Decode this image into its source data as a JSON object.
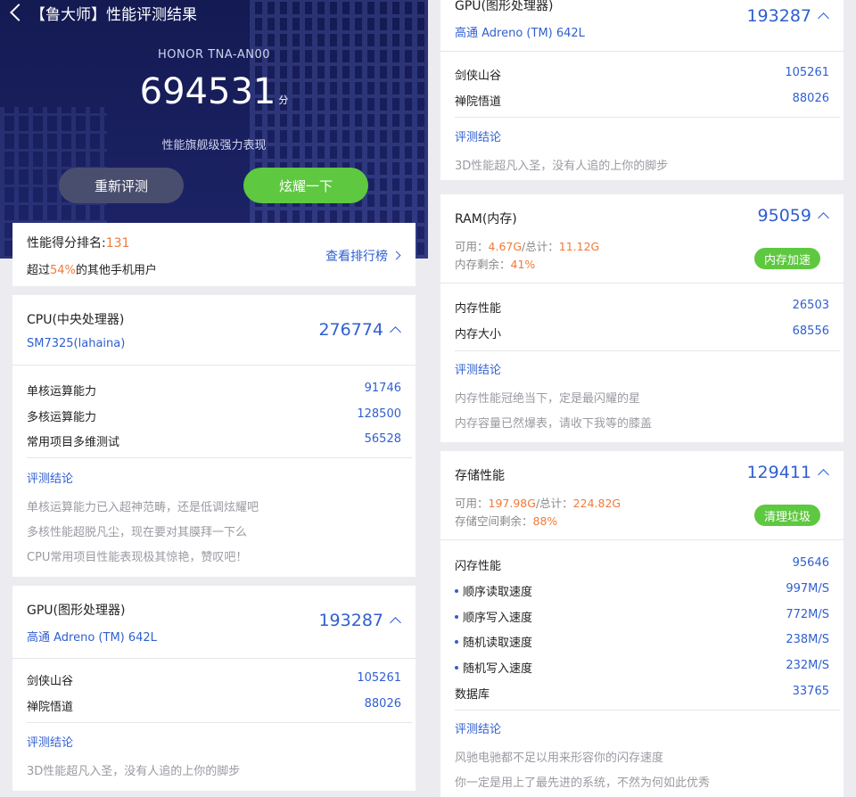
{
  "header": {
    "title": "【鲁大师】性能评测结果",
    "model": "HONOR TNA-AN00",
    "score": "694531",
    "unit": "分",
    "slogan": "性能旗舰级强力表现",
    "retest": "重新评测",
    "show_off": "炫耀一下"
  },
  "rank": {
    "label": "性能得分排名:",
    "rank": "131",
    "prefix": "超过",
    "percent": "54%",
    "suffix": "的其他手机用户",
    "link": "查看排行榜"
  },
  "cpu": {
    "name": "CPU(中央处理器)",
    "model": "SM7325(lahaina)",
    "score": "276774",
    "rows": [
      {
        "label": "单核运算能力",
        "value": "91746"
      },
      {
        "label": "多核运算能力",
        "value": "128500"
      },
      {
        "label": "常用项目多维测试",
        "value": "56528"
      }
    ],
    "conclusion": "评测结论",
    "lines": [
      "单核运算能力已入超神范畴，还是低调炫耀吧",
      "多核性能超脱凡尘，现在要对其膜拜一下么",
      "CPU常用项目性能表现极其惊艳，赞叹吧！"
    ]
  },
  "gpu": {
    "name": "GPU(图形处理器)",
    "model": "高通 Adreno (TM) 642L",
    "score": "193287",
    "rows": [
      {
        "label": "剑侠山谷",
        "value": "105261"
      },
      {
        "label": "禅院悟道",
        "value": "88026"
      }
    ],
    "conclusion": "评测结论",
    "lines": [
      "3D性能超凡入圣，没有人追的上你的脚步"
    ]
  },
  "ram": {
    "name": "RAM(内存)",
    "score": "95059",
    "avail_label": "可用：",
    "avail": "4.67G",
    "total_label": "/总计：",
    "total": "11.12G",
    "remain_label": "内存剩余：",
    "remain": "41%",
    "button": "内存加速",
    "rows": [
      {
        "label": "内存性能",
        "value": "26503"
      },
      {
        "label": "内存大小",
        "value": "68556"
      }
    ],
    "conclusion": "评测结论",
    "lines": [
      "内存性能冠绝当下，定是最闪耀的星",
      "内存容量已然爆表，请收下我等的膝盖"
    ]
  },
  "storage": {
    "name": "存储性能",
    "score": "129411",
    "avail_label": "可用：",
    "avail": "197.98G",
    "total_label": "/总计：",
    "total": "224.82G",
    "remain_label": "存储空间剩余：",
    "remain": "88%",
    "button": "清理垃圾",
    "rows": [
      {
        "label": "闪存性能",
        "value": "95646"
      },
      {
        "label": "顺序读取速度",
        "value": "997M/S"
      },
      {
        "label": "顺序写入速度",
        "value": "772M/S"
      },
      {
        "label": "随机读取速度",
        "value": "238M/S"
      },
      {
        "label": "随机写入速度",
        "value": "232M/S"
      },
      {
        "label": "数据库",
        "value": "33765"
      }
    ],
    "conclusion": "评测结论",
    "lines": [
      "风驰电驰都不足以用来形容你的闪存速度",
      "你一定是用上了最先进的系统，不然为何如此优秀"
    ]
  }
}
